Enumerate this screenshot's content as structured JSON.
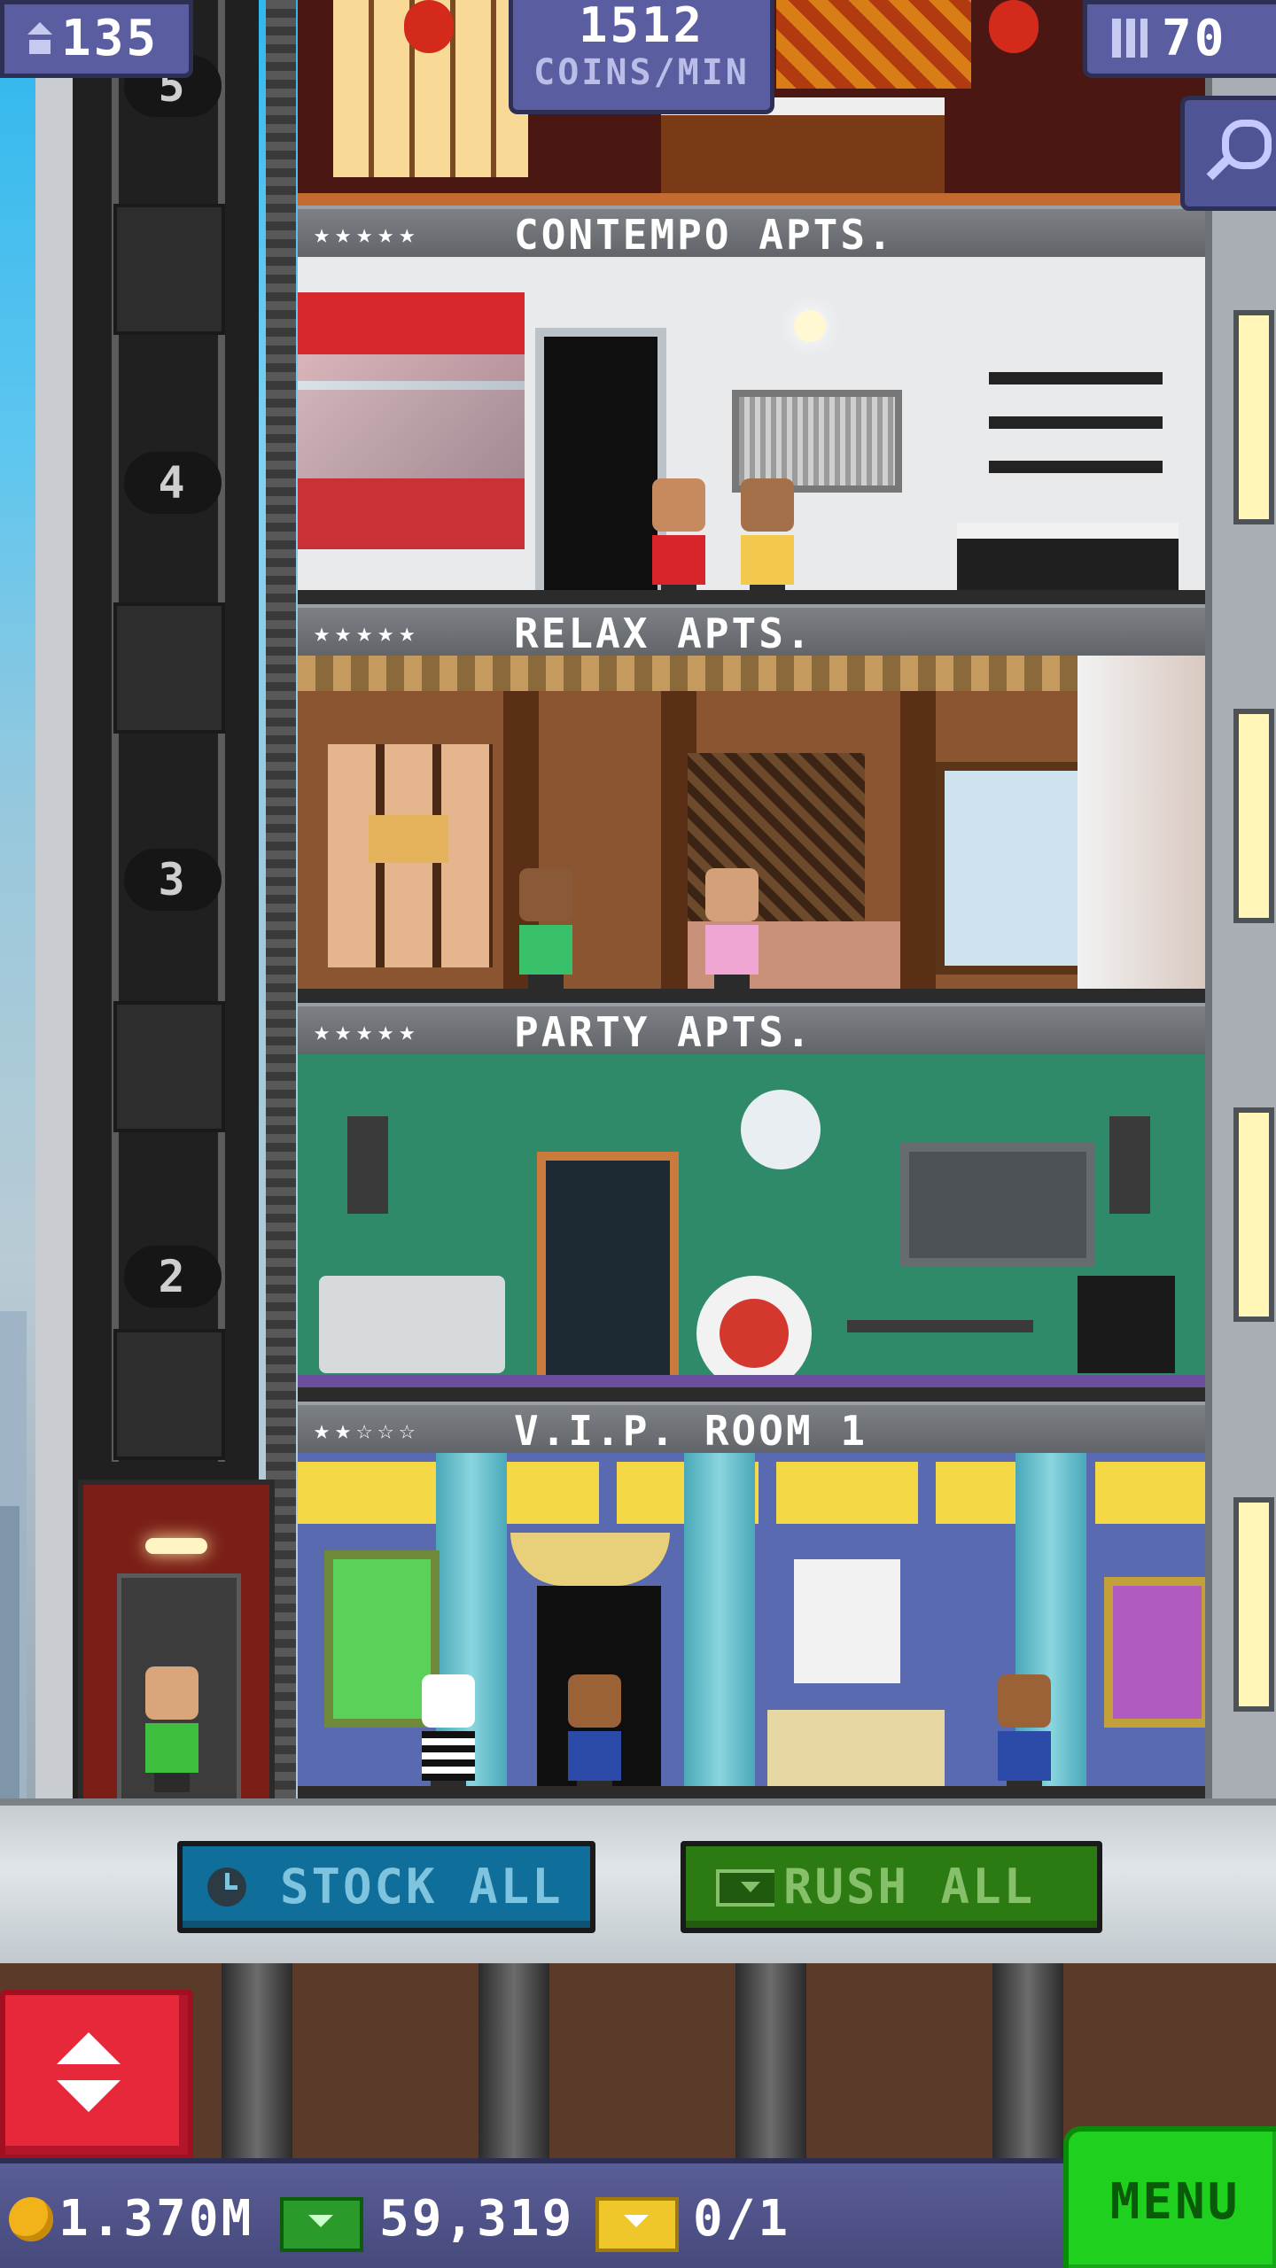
{
  "hud": {
    "population": "135",
    "coins_per_min_value": "1512",
    "coins_per_min_label": "COINS/MIN",
    "floor_count": "70",
    "icons": {
      "population": "person-up-icon",
      "floors": "building-icon",
      "search": "magnifier-icon"
    }
  },
  "elevator": {
    "floor_numbers": [
      "5",
      "4",
      "3",
      "2"
    ]
  },
  "floors": [
    {
      "name": "CONTEMPO APTS.",
      "stars": "★★★★★"
    },
    {
      "name": "RELAX APTS.",
      "stars": "★★★★★"
    },
    {
      "name": "PARTY APTS.",
      "stars": "★★★★★"
    },
    {
      "name": "V.I.P. ROOM 1",
      "stars": "★★☆☆☆"
    }
  ],
  "actions": {
    "stock_all": "STOCK ALL",
    "rush_all": "RUSH ALL"
  },
  "resources": {
    "coins": "1.370M",
    "bux": "59,319",
    "tickets": "0/1"
  },
  "menu": {
    "label": "MENU"
  },
  "colors": {
    "hud": "#5a5ea0",
    "stock_button": "#0f6e9a",
    "rush_button": "#2c7a12",
    "menu_button": "#1fd01f",
    "elevator_nav": "#e6283a"
  }
}
